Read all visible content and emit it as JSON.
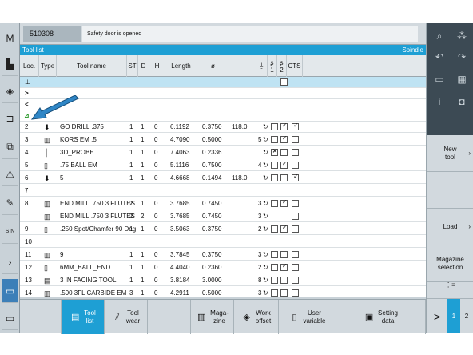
{
  "header": {
    "program_id": "510308",
    "alarm_text": "Safety door is opened"
  },
  "titlebar": {
    "left": "Tool list",
    "right": "Spindle"
  },
  "columns": {
    "loc": "Loc.",
    "type": "Type",
    "tool_name": "Tool name",
    "st": "ST",
    "d": "D",
    "h": "H",
    "length": "Length",
    "dia": "ø",
    "s1": "1",
    "s2": "2",
    "cts": "CTS"
  },
  "rows": [
    {
      "loc": "2",
      "name": "GO DRILL .375",
      "st": "1",
      "d": "1",
      "h": "0",
      "length": "6.1192",
      "dia": "0.3750",
      "angle": "118.0",
      "n": "",
      "cb1": "",
      "cb2": "on",
      "cb3": "on",
      "icon": "drill"
    },
    {
      "loc": "3",
      "name": "KORS EM .5",
      "st": "1",
      "d": "1",
      "h": "0",
      "length": "4.7090",
      "dia": "0.5000",
      "angle": "",
      "n": "5",
      "cb1": "",
      "cb2": "on",
      "cb3": "",
      "icon": "mill"
    },
    {
      "loc": "4",
      "name": "3D_PROBE",
      "st": "1",
      "d": "1",
      "h": "0",
      "length": "7.4063",
      "dia": "0.2336",
      "angle": "",
      "n": "",
      "cb1": "x",
      "cb2": "",
      "cb3": "",
      "icon": "probe"
    },
    {
      "loc": "5",
      "name": ".75 BALL EM",
      "st": "1",
      "d": "1",
      "h": "0",
      "length": "5.1116",
      "dia": "0.7500",
      "angle": "",
      "n": "4",
      "cb1": "",
      "cb2": "on",
      "cb3": "",
      "icon": "ball"
    },
    {
      "loc": "6",
      "name": "5",
      "st": "1",
      "d": "1",
      "h": "0",
      "length": "4.6668",
      "dia": "0.1494",
      "angle": "118.0",
      "n": "",
      "cb1": "",
      "cb2": "",
      "cb3": "on",
      "icon": "drill"
    },
    {
      "loc": "7",
      "name": "",
      "st": "",
      "d": "",
      "h": "",
      "length": "",
      "dia": "",
      "angle": "",
      "n": "",
      "cb1": "",
      "cb2": "",
      "cb3": "",
      "icon": ""
    },
    {
      "loc": "8",
      "name": "END MILL .750 3 FLUTES",
      "st": "2",
      "d": "1",
      "h": "0",
      "length": "3.7685",
      "dia": "0.7450",
      "angle": "",
      "n": "3",
      "cb1": "",
      "cb2": "on",
      "cb3": "",
      "icon": "mill"
    },
    {
      "loc": "",
      "name": "END MILL .750 3 FLUTES",
      "st": "2",
      "d": "2",
      "h": "0",
      "length": "3.7685",
      "dia": "0.7450",
      "angle": "",
      "n": "3",
      "cb1": "-",
      "cb2": "-",
      "cb3": "",
      "icon": "mill"
    },
    {
      "loc": "9",
      "name": ".250 Spot/Chamfer 90 Deg",
      "st": "1",
      "d": "1",
      "h": "0",
      "length": "3.5063",
      "dia": "0.3750",
      "angle": "",
      "n": "2",
      "cb1": "",
      "cb2": "on",
      "cb3": "",
      "icon": "ball"
    },
    {
      "loc": "10",
      "name": "",
      "st": "",
      "d": "",
      "h": "",
      "length": "",
      "dia": "",
      "angle": "",
      "n": "",
      "cb1": "",
      "cb2": "",
      "cb3": "",
      "icon": ""
    },
    {
      "loc": "11",
      "name": "9",
      "st": "1",
      "d": "1",
      "h": "0",
      "length": "3.7845",
      "dia": "0.3750",
      "angle": "",
      "n": "3",
      "cb1": "",
      "cb2": "",
      "cb3": "",
      "icon": "mill"
    },
    {
      "loc": "12",
      "name": "6MM_BALL_END",
      "st": "1",
      "d": "1",
      "h": "0",
      "length": "4.4040",
      "dia": "0.2360",
      "angle": "",
      "n": "2",
      "cb1": "",
      "cb2": "on",
      "cb3": "",
      "icon": "ball"
    },
    {
      "loc": "13",
      "name": "3 IN FACING TOOL",
      "st": "1",
      "d": "1",
      "h": "0",
      "length": "3.8184",
      "dia": "3.0000",
      "angle": "",
      "n": "8",
      "cb1": "",
      "cb2": "",
      "cb3": "",
      "icon": "face"
    },
    {
      "loc": "14",
      "name": ".500 3FL CARBIDE EM",
      "st": "3",
      "d": "1",
      "h": "0",
      "length": "4.2911",
      "dia": "0.5000",
      "angle": "",
      "n": "3",
      "cb1": "",
      "cb2": "",
      "cb3": "",
      "icon": "mill"
    }
  ],
  "hsoftkeys": [
    {
      "label": "Tool\nlist",
      "icon": "tool-list-icon"
    },
    {
      "label": "Tool\nwear",
      "icon": "tool-wear-icon"
    },
    {
      "label": "",
      "icon": ""
    },
    {
      "label": "Maga-\nzine",
      "icon": "magazine-icon"
    },
    {
      "label": "Work\noffset",
      "icon": "work-offset-icon"
    },
    {
      "label": "User\nvariable",
      "icon": "user-variable-icon"
    },
    {
      "label": "Setting\ndata",
      "icon": "setting-data-icon"
    }
  ],
  "hsk_nav": {
    "next": ">",
    "p1": "1",
    "p2": "2"
  },
  "vsoftkeys": {
    "new_tool": "New\ntool",
    "load": "Load",
    "magazine_selection": "Magazine\nselection"
  },
  "left_icons": [
    "machine-icon",
    "edit-icon",
    "program-icon",
    "bracket-icon",
    "copy-icon",
    "warning-icon",
    "wrench-icon",
    "sinumerik-icon",
    "chevron-icon",
    "window-icon",
    "window2-icon"
  ]
}
